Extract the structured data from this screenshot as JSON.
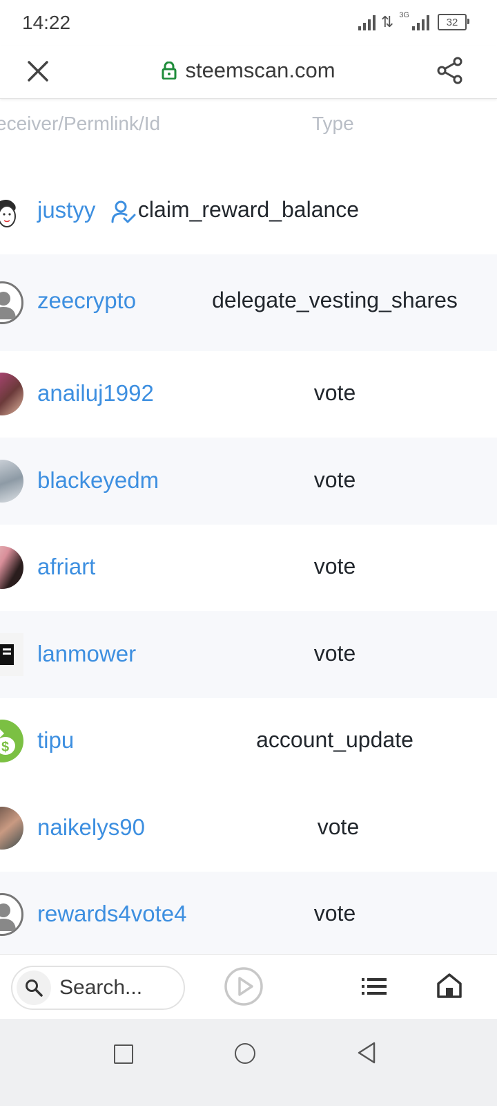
{
  "status_bar": {
    "time": "14:22",
    "network_type": "3G",
    "battery": "32"
  },
  "url_bar": {
    "url": "steemscan.com"
  },
  "table": {
    "header_receiver": "eceiver/Permlink/Id",
    "header_type": "Type",
    "rows": [
      {
        "user": "justyy",
        "type": "claim_reward_balance",
        "verified": true
      },
      {
        "user": "zeecrypto",
        "type": "delegate_vesting_shares"
      },
      {
        "user": "anailuj1992",
        "type": "vote"
      },
      {
        "user": "blackeyedm",
        "type": "vote"
      },
      {
        "user": "afriart",
        "type": "vote"
      },
      {
        "user": "lanmower",
        "type": "vote"
      },
      {
        "user": "tipu",
        "type": "account_update"
      },
      {
        "user": "naikelys90",
        "type": "vote"
      },
      {
        "user": "rewards4vote4",
        "type": "vote"
      }
    ]
  },
  "bottom_bar": {
    "search_placeholder": "Search..."
  },
  "colors": {
    "link": "#3d8fe0",
    "alt_row": "#f7f8fb",
    "lock": "#1e8c3a"
  }
}
